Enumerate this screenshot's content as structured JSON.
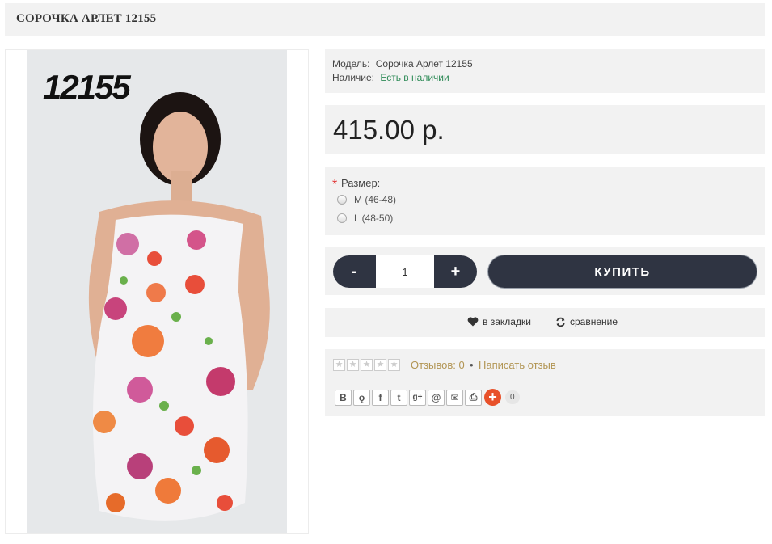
{
  "product": {
    "title": "СОРОЧКА АРЛЕТ 12155",
    "image_code": "12155",
    "model_label": "Модель:",
    "model_value": "Сорочка Арлет 12155",
    "availability_label": "Наличие:",
    "availability_value": "Есть в наличии",
    "price": "415.00 р."
  },
  "options": {
    "required_mark": "*",
    "size_label": "Размер:",
    "sizes": [
      "M (46-48)",
      "L (48-50)"
    ]
  },
  "cart": {
    "minus": "-",
    "quantity": "1",
    "plus": "+",
    "buy_label": "КУПИТЬ"
  },
  "actions": {
    "bookmark_label": "в закладки",
    "compare_label": "сравнение"
  },
  "reviews": {
    "rating": 0,
    "max_rating": 5,
    "reviews_link": "Отзывов: 0",
    "separator": "•",
    "write_link": "Написать отзыв"
  },
  "share": {
    "buttons": [
      "vk-icon",
      "odnoklassniki-icon",
      "facebook-icon",
      "twitter-icon",
      "google-plus-icon",
      "mail-ru-icon",
      "email-icon",
      "print-icon"
    ],
    "glyphs": {
      "vk": "B",
      "ok": "ǫ",
      "fb": "f",
      "tw": "t",
      "gp": "g+",
      "mr": "@",
      "em": "✉",
      "pr": "⎙"
    },
    "plus": "+",
    "count": "0"
  },
  "colors": {
    "panel_bg": "#f2f2f2",
    "button_dark": "#2f3442",
    "availability": "#2e8b57",
    "link_gold": "#b29553",
    "share_orange": "#e8512a"
  }
}
